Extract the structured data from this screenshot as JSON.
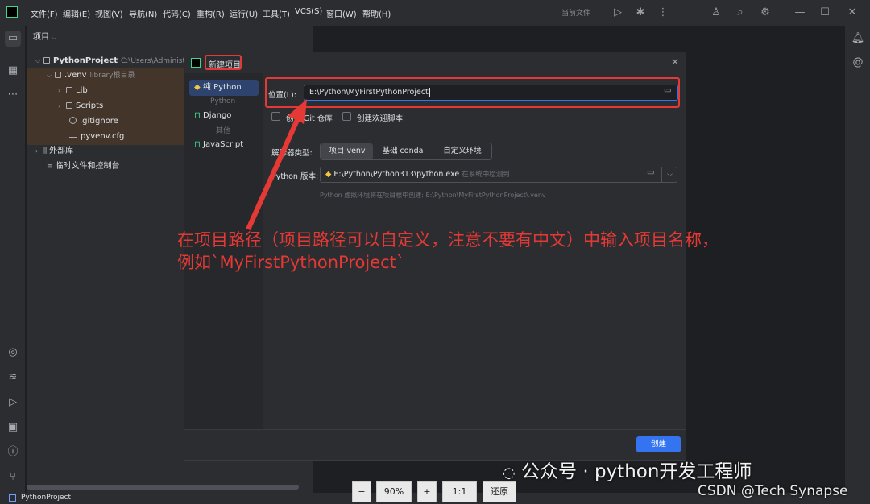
{
  "menu": [
    "文件(F)",
    "编辑(E)",
    "视图(V)",
    "导航(N)",
    "代码(C)",
    "重构(R)",
    "运行(U)",
    "工具(T)",
    "VCS(S)",
    "窗口(W)",
    "帮助(H)"
  ],
  "titlebar": {
    "run_config": "当前文件"
  },
  "project_panel": {
    "title": "项目",
    "root_name": "PythonProject",
    "root_path": "C:\\Users\\Administ",
    "venv_name": ".venv",
    "venv_note": "library根目录",
    "items": [
      "Lib",
      "Scripts",
      ".gitignore",
      "pyvenv.cfg"
    ],
    "external": "外部库",
    "scratch": "临时文件和控制台"
  },
  "dialog": {
    "title": "新建项目",
    "side": {
      "pure_python": "纯 Python",
      "group_python": "Python",
      "django": "Django",
      "group_other": "其他",
      "javascript": "JavaScript"
    },
    "location_label": "位置(L):",
    "location_value": "E:\\Python\\MyFirstPythonProject",
    "create_git": "创建 Git 仓库",
    "create_welcome": "创建欢迎脚本",
    "interpreter_label": "解释器类型:",
    "interpreter_options": [
      "项目 venv",
      "基础 conda",
      "自定义环境"
    ],
    "python_version_label": "Python 版本:",
    "python_version_value": "E:\\Python\\Python313\\python.exe",
    "python_version_note": "在系统中检测到",
    "venv_hint": "Python 虚拟环境将在项目根中创建: E:\\Python\\MyFirstPythonProject\\.venv",
    "create_button": "创建"
  },
  "annotation": {
    "line1": "在项目路径（项目路径可以自定义，注意不要有中文）中输入项目名称，",
    "line2": "例如`MyFirstPythonProject`"
  },
  "zoom": {
    "minus": "−",
    "level": "90%",
    "plus": "+",
    "ratio": "1:1",
    "reset": "还原"
  },
  "watermark": {
    "wechat": "公众号 · python开发工程师",
    "csdn": "CSDN @Tech Synapse"
  },
  "statusbar": {
    "project": "PythonProject"
  }
}
